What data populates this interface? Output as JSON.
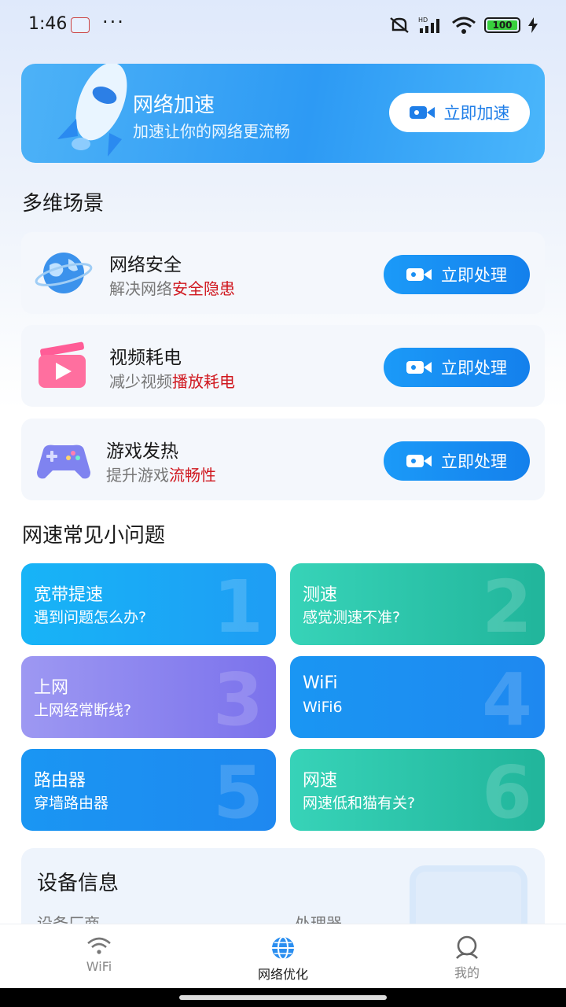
{
  "status_bar": {
    "time": "1:46",
    "dots": "···",
    "battery": "100"
  },
  "banner": {
    "title": "网络加速",
    "subtitle": "加速让你的网络更流畅",
    "button_label": "立即加速"
  },
  "scenes": {
    "section_title": "多维场景",
    "items": [
      {
        "title": "网络安全",
        "desc_plain": "解决网络",
        "desc_highlight": "安全隐患",
        "button_label": "立即处理",
        "icon": "globe-icon"
      },
      {
        "title": "视频耗电",
        "desc_plain": "减少视频",
        "desc_highlight": "播放耗电",
        "button_label": "立即处理",
        "icon": "video-play-icon"
      },
      {
        "title": "游戏发热",
        "desc_plain": "提升游戏",
        "desc_highlight": "流畅性",
        "button_label": "立即处理",
        "icon": "gamepad-icon"
      }
    ]
  },
  "faq": {
    "section_title": "网速常见小问题",
    "items": [
      {
        "title": "宽带提速",
        "subtitle": "遇到问题怎么办?",
        "number": "1"
      },
      {
        "title": "测速",
        "subtitle": "感觉测速不准?",
        "number": "2"
      },
      {
        "title": "上网",
        "subtitle": "上网经常断线?",
        "number": "3"
      },
      {
        "title": "WiFi",
        "subtitle": "WiFi6",
        "number": "4"
      },
      {
        "title": "路由器",
        "subtitle": "穿墙路由器",
        "number": "5"
      },
      {
        "title": "网速",
        "subtitle": "网速低和猫有关?",
        "number": "6"
      }
    ]
  },
  "device": {
    "title": "设备信息",
    "label_manufacturer": "设备厂商",
    "label_processor": "处理器"
  },
  "tabbar": {
    "items": [
      {
        "label": "WiFi",
        "icon": "wifi-icon",
        "active": false
      },
      {
        "label": "网络优化",
        "icon": "globe-icon",
        "active": true
      },
      {
        "label": "我的",
        "icon": "user-icon",
        "active": false
      }
    ]
  },
  "colors": {
    "primary_blue": "#1b8ff2",
    "highlight_red": "#d0181f",
    "teal": "#2cc4a9",
    "purple": "#8c86ef"
  }
}
